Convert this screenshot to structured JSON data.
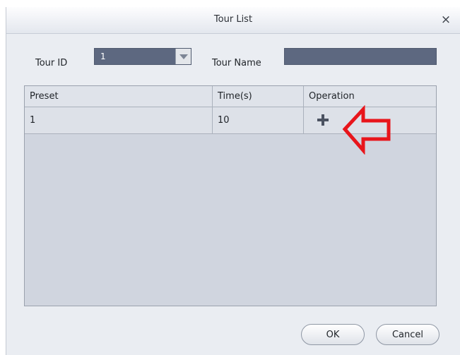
{
  "dialog": {
    "title": "Tour List",
    "close_glyph": "×"
  },
  "form": {
    "tour_id_label": "Tour ID",
    "tour_id_value": "1",
    "tour_name_label": "Tour Name",
    "tour_name_value": ""
  },
  "table": {
    "columns": [
      "Preset",
      "Time(s)",
      "Operation"
    ],
    "rows": [
      {
        "preset": "1",
        "time": "10",
        "operation_icon": "plus-icon"
      }
    ]
  },
  "annotation": {
    "arrow_color": "#e8151b",
    "arrow_icon": "arrow-left-outline-icon"
  },
  "buttons": {
    "ok": "OK",
    "cancel": "Cancel"
  },
  "colors": {
    "dialog_bg": "#eaedf2",
    "field_bg": "#5d6880",
    "grid_bg": "#d0d5df"
  }
}
